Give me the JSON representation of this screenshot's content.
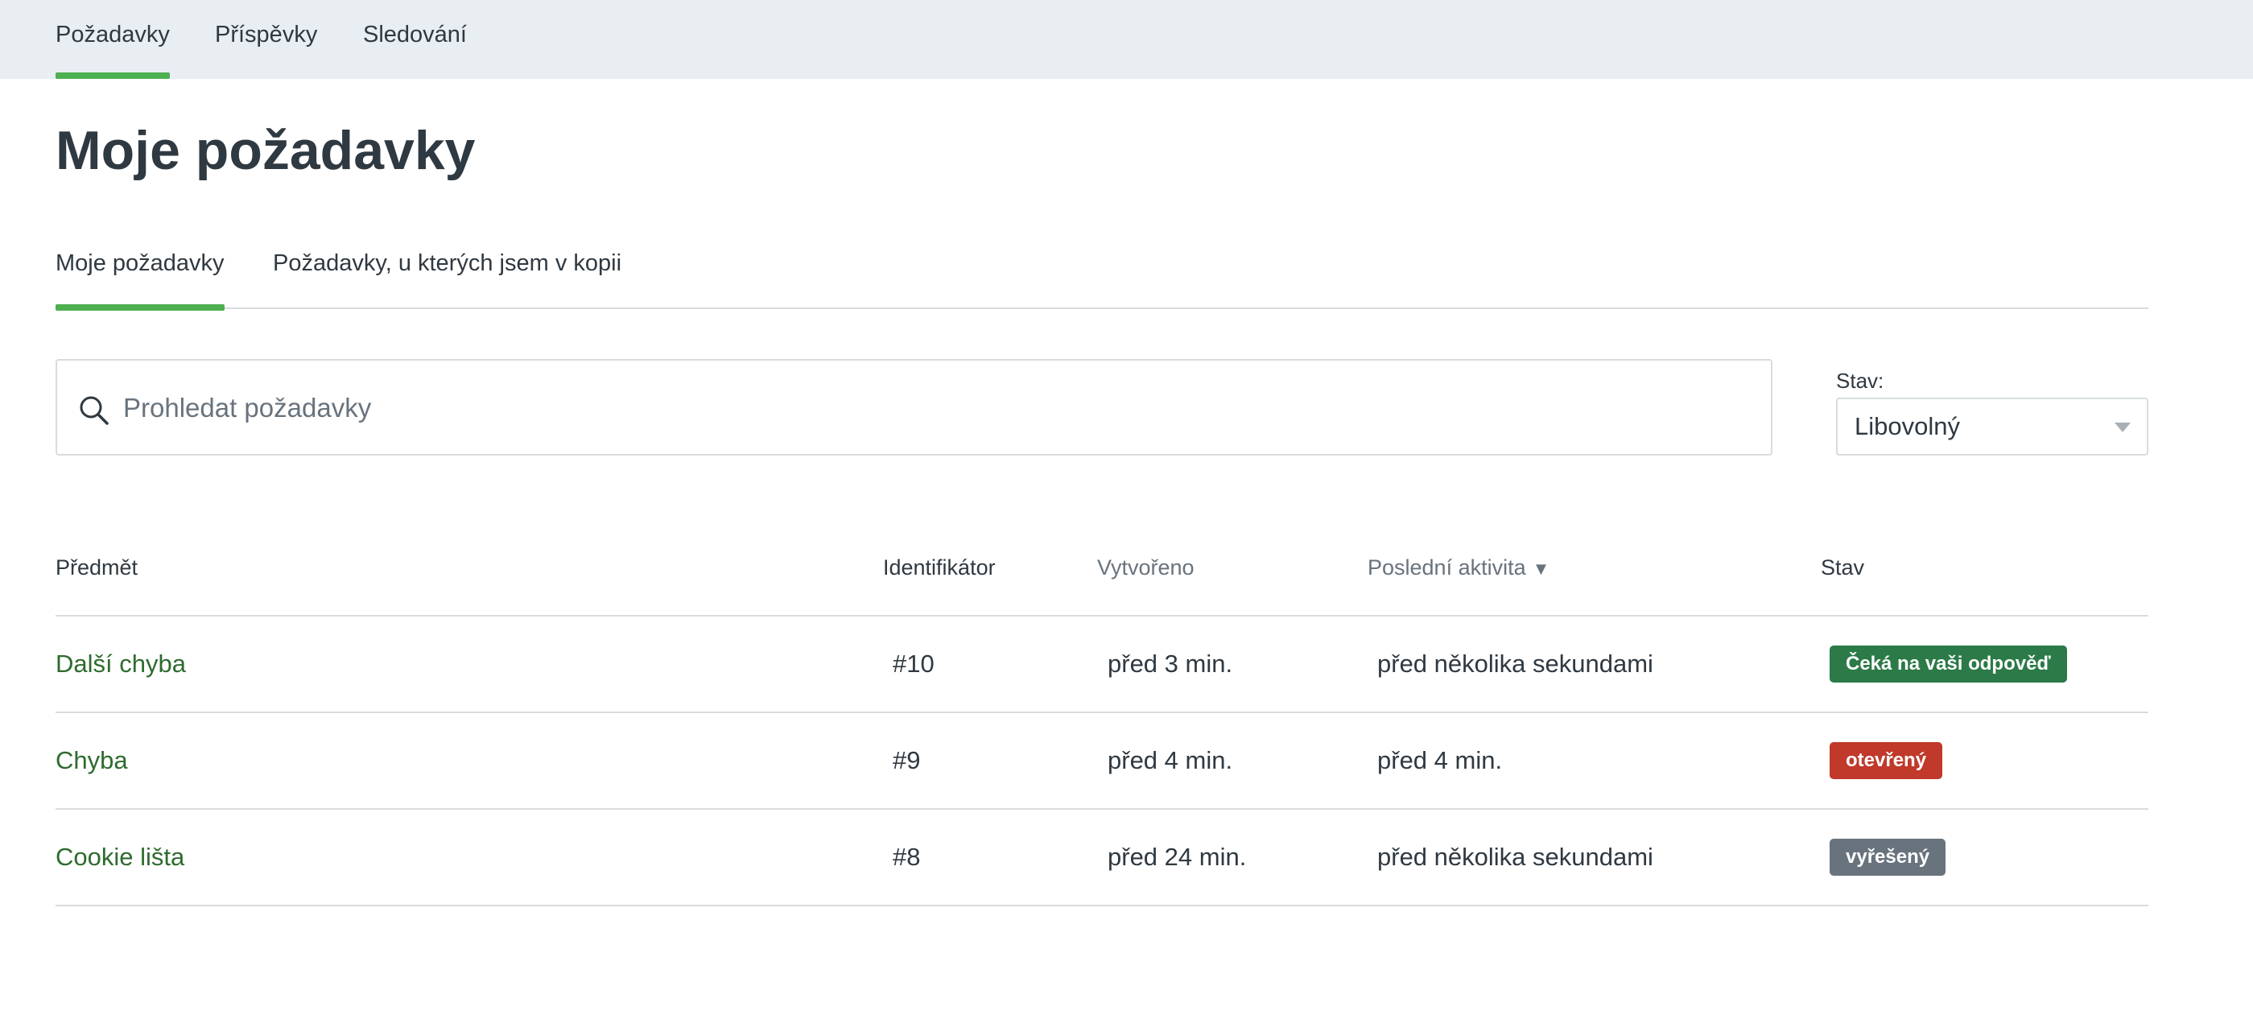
{
  "topnav": {
    "items": [
      {
        "label": "Požadavky",
        "active": true
      },
      {
        "label": "Příspěvky",
        "active": false
      },
      {
        "label": "Sledování",
        "active": false
      }
    ]
  },
  "page_title": "Moje požadavky",
  "subtabs": [
    {
      "label": "Moje požadavky",
      "active": true
    },
    {
      "label": "Požadavky, u kterých jsem v kopii",
      "active": false
    }
  ],
  "search": {
    "placeholder": "Prohledat požadavky",
    "value": ""
  },
  "status_filter": {
    "label": "Stav:",
    "selected": "Libovolný"
  },
  "table": {
    "columns": {
      "subject": "Předmět",
      "id": "Identifikátor",
      "created": "Vytvořeno",
      "last_activity": "Poslední aktivita",
      "last_activity_sort": "▼",
      "status": "Stav"
    },
    "rows": [
      {
        "subject": "Další chyba",
        "id": "#10",
        "created": "před 3 min.",
        "last_activity": "před několika sekundami",
        "status": "Čeká na vaši odpověď",
        "status_color": "#2b7a47"
      },
      {
        "subject": "Chyba",
        "id": "#9",
        "created": "před 4 min.",
        "last_activity": "před 4 min.",
        "status": "otevřený",
        "status_color": "#c0392b"
      },
      {
        "subject": "Cookie lišta",
        "id": "#8",
        "created": "před 24 min.",
        "last_activity": "před několika sekundami",
        "status": "vyřešený",
        "status_color": "#68737d"
      }
    ]
  },
  "colors": {
    "accent": "#4caf50",
    "link": "#2e6b2e",
    "nav_bg": "#e9eef2"
  }
}
